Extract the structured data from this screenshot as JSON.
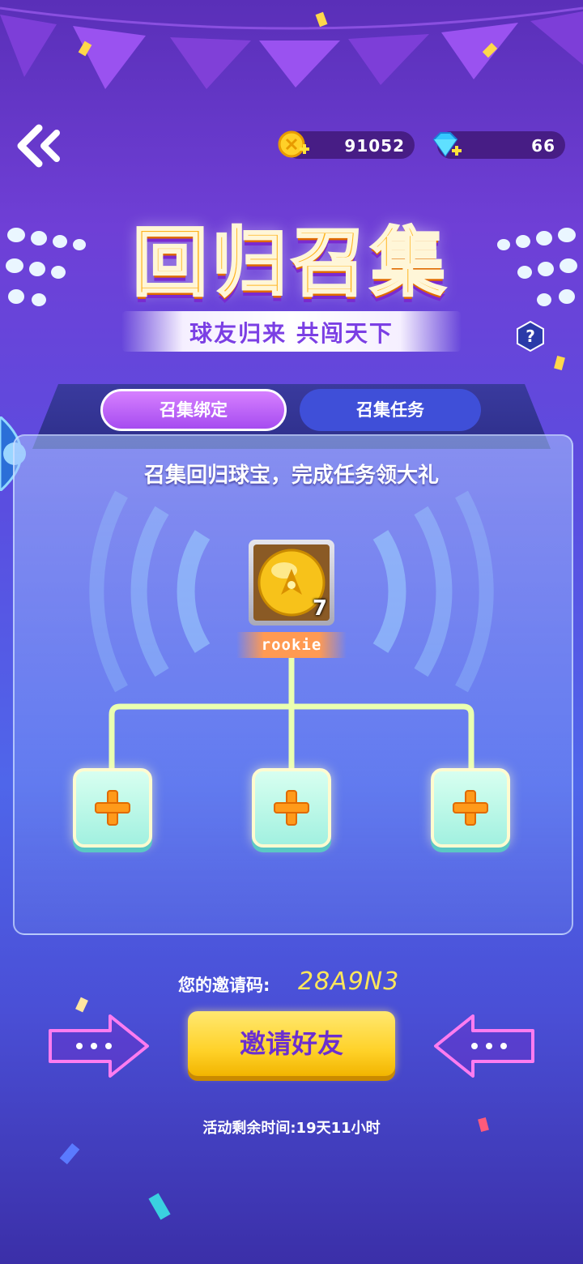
{
  "header": {
    "back_icon": "double-chevron-left-icon",
    "coins": {
      "icon": "coin-plus-icon",
      "value": "91052"
    },
    "gems": {
      "icon": "diamond-plus-icon",
      "value": "66"
    }
  },
  "banner": {
    "title": "回归召集",
    "subtitle": "球友归来  共闯天下",
    "help_label": "?"
  },
  "tabs": [
    {
      "label": "召集绑定",
      "active": true
    },
    {
      "label": "召集任务",
      "active": false
    }
  ],
  "panel": {
    "instruction": "召集回归球宝，完成任务领大礼",
    "player": {
      "name": "rookie",
      "level": "7",
      "avatar_icon": "golden-ball-avatar-icon"
    },
    "slots": [
      {
        "icon": "plus-icon"
      },
      {
        "icon": "plus-icon"
      },
      {
        "icon": "plus-icon"
      }
    ]
  },
  "invite": {
    "label": "您的邀请码:",
    "code": "28A9N3",
    "button_label": "邀请好友"
  },
  "footer": {
    "countdown": "活动剩余时间:19天11小时"
  },
  "colors": {
    "accent_yellow": "#ffd22a",
    "accent_purple": "#a64cf0",
    "slot_teal": "#a2f1e0",
    "code_yellow": "#ffe75a"
  }
}
